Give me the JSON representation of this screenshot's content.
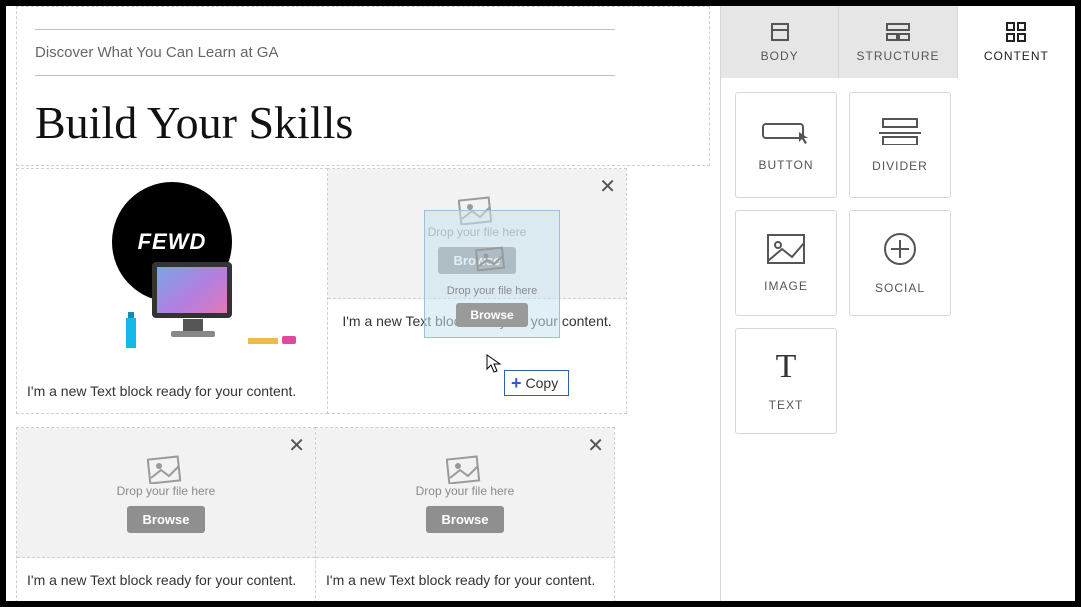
{
  "header": {
    "discover": "Discover What You Can Learn at GA",
    "headline": "Build Your Skills"
  },
  "fewd_badge": "FEWD",
  "blocks": {
    "placeholder_text": "I'm a new Text block ready for your content.",
    "drop_hint": "Drop your file here",
    "browse_label": "Browse"
  },
  "drag": {
    "tooltip": "Copy"
  },
  "sidebar": {
    "tabs": {
      "body": "BODY",
      "structure": "STRUCTURE",
      "content": "CONTENT"
    },
    "widgets": {
      "button": "BUTTON",
      "divider": "DIVIDER",
      "image": "IMAGE",
      "social": "SOCIAL",
      "text": "TEXT"
    }
  }
}
